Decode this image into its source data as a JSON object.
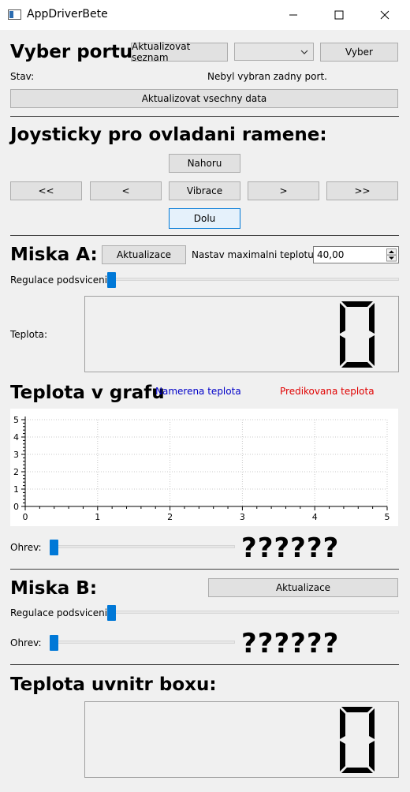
{
  "window": {
    "title": "AppDriverBete",
    "icon": "app-window-icon"
  },
  "port": {
    "heading": "Vyber portu:",
    "refresh_list_label": "Aktualizovat seznam",
    "combo_value": "",
    "select_label": "Vyber",
    "status_label": "Stav:",
    "status_value": "Nebyl vybran zadny port.",
    "refresh_all_label": "Aktualizovat vsechny data"
  },
  "joystick": {
    "heading": "Joysticky pro ovladani ramene:",
    "up_label": "Nahoru",
    "fast_left_label": "<<",
    "left_label": "<",
    "vibrate_label": "Vibrace",
    "right_label": ">",
    "fast_right_label": ">>",
    "down_label": "Dolu"
  },
  "bowl_a": {
    "heading": "Miska A:",
    "refresh_label": "Aktualizace",
    "max_temp_label": "Nastav maximalni teplotu:",
    "max_temp_value": "40,00",
    "backlight_label": "Regulace podsviceni",
    "backlight_level": 0,
    "temp_label": "Teplota:",
    "lcd_value": "0"
  },
  "graph": {
    "heading": "Teplota v grafu",
    "measured_label": "Namerena teplota",
    "predicted_label": "Predikovana teplota",
    "colors": {
      "measured": "#0000c8",
      "predicted": "#e00000"
    }
  },
  "chart_data": {
    "type": "line",
    "series": [
      {
        "name": "Namerena teplota",
        "values": []
      },
      {
        "name": "Predikovana teplota",
        "values": []
      }
    ],
    "xlim": [
      0,
      5
    ],
    "ylim": [
      0,
      5
    ],
    "x_ticks": [
      "0",
      "1",
      "2",
      "3",
      "4",
      "5"
    ],
    "y_ticks": [
      "0",
      "1",
      "2",
      "3",
      "4",
      "5"
    ],
    "grid": true,
    "legend": "top"
  },
  "heating_a": {
    "label": "Ohrev:",
    "level": 0,
    "value": "??????"
  },
  "bowl_b": {
    "heading": "Miska B:",
    "refresh_label": "Aktualizace",
    "backlight_label": "Regulace podsviceni",
    "backlight_level": 0,
    "heat_label": "Ohrev:",
    "heat_level": 0,
    "heat_value": "??????"
  },
  "box": {
    "heading": "Teplota uvnitr boxu:",
    "lcd_value": "0"
  }
}
